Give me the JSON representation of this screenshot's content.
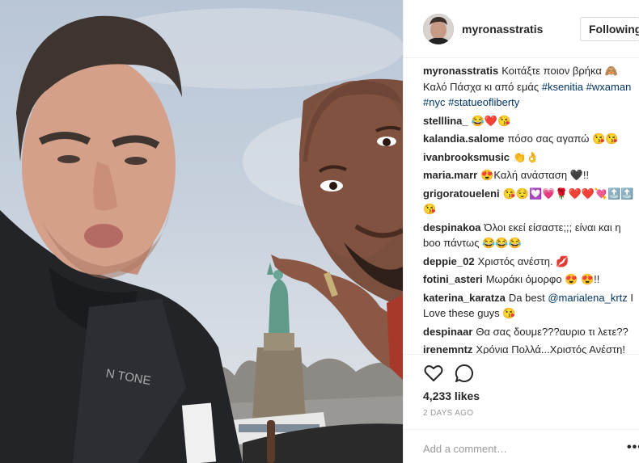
{
  "post": {
    "username": "myronasstratis",
    "follow_label": "Following",
    "photo_alt": "",
    "caption": {
      "user": "myronasstratis",
      "text": "Κοιτάξτε ποιον βρήκα 🙈 Καλό Πάσχα κι από εμάς ",
      "tags": [
        "#ksenitia",
        "#wxaman",
        "#nyc",
        "#statueofliberty"
      ]
    }
  },
  "comments": [
    {
      "user": "stelllina_",
      "text": "😂❤️😘"
    },
    {
      "user": "kalandia.salome",
      "text": "πόσο σας αγαπώ 😘😘"
    },
    {
      "user": "ivanbrooksmusic",
      "text": "👏👌"
    },
    {
      "user": "maria.marr",
      "text": "😍Καλή ανάσταση 🖤!!"
    },
    {
      "user": "grigoratoueleni",
      "text": "😘😌💟💗🌹❤️❤️💘🔝🔝😘"
    },
    {
      "user": "despinakoa",
      "text": "Όλοι εκεί είσαστε;;; είναι και η boo πάντως 😂😂😂"
    },
    {
      "user": "deppie_02",
      "text": "Χριστός ανέστη. 💋"
    },
    {
      "user": "fotini_asteri",
      "text": "Μωράκι όμορφο 😍 😍!!"
    },
    {
      "user": "katerina_karatza",
      "text": "Da best ",
      "mention": "@marialena_krtz",
      "text_after": " I Love these guys 😘"
    },
    {
      "user": "despinaar",
      "text": "Θα σας δουμε???αυριο τι λετε??"
    },
    {
      "user": "irenemntz",
      "text": "Χρόνια Πολλά...Χριστός Ανέστη!"
    }
  ],
  "actions": {
    "like_icon": "heart-icon",
    "comment_icon": "comment-icon",
    "likes_text": "4,233 likes",
    "date_text": "2 DAYS AGO",
    "comment_placeholder": "Add a comment…",
    "more_label": "•••"
  },
  "colors": {
    "tag": "#003569",
    "border": "#efefef",
    "muted": "#999999"
  }
}
